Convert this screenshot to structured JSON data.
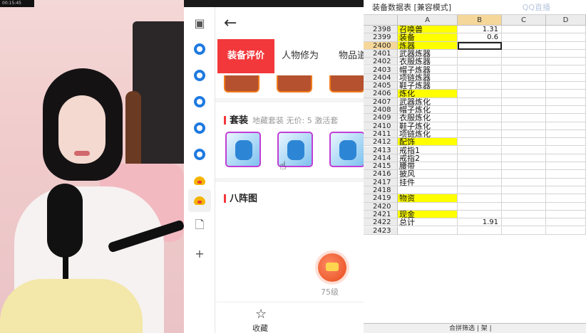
{
  "webcam": {
    "corner_text": "00:15:45"
  },
  "panel": {
    "tabs": [
      "装备评价",
      "人物修为",
      "物品道"
    ],
    "suit_section": {
      "title": "套装",
      "meta": "地藏套装  无价: 5  激活套"
    },
    "formation_section": {
      "title": "八阵图"
    },
    "level": "75级",
    "fav_label": "收藏"
  },
  "sheet": {
    "title": "装备数据表 [兼容模式]",
    "watermark": "QQ直播",
    "columns": [
      "A",
      "B",
      "C",
      "D"
    ],
    "selected_column": "B",
    "rows": [
      {
        "n": "2398",
        "a": "召唤兽",
        "b": "1.31",
        "hl": true
      },
      {
        "n": "2399",
        "a": "装备",
        "b": "0.6",
        "hl": true
      },
      {
        "n": "2400",
        "a": "炼器",
        "b": "",
        "hl": true,
        "sel": true
      },
      {
        "n": "2401",
        "a": "武器炼器",
        "b": ""
      },
      {
        "n": "2402",
        "a": "衣服炼器",
        "b": ""
      },
      {
        "n": "2403",
        "a": "帽子炼器",
        "b": ""
      },
      {
        "n": "2404",
        "a": "项链炼器",
        "b": ""
      },
      {
        "n": "2405",
        "a": "鞋子炼器",
        "b": ""
      },
      {
        "n": "2406",
        "a": "炼化",
        "b": "",
        "hl": true
      },
      {
        "n": "2407",
        "a": "武器炼化",
        "b": ""
      },
      {
        "n": "2408",
        "a": "帽子炼化",
        "b": ""
      },
      {
        "n": "2409",
        "a": "衣服炼化",
        "b": ""
      },
      {
        "n": "2410",
        "a": "鞋子炼化",
        "b": ""
      },
      {
        "n": "2411",
        "a": "项链炼化",
        "b": ""
      },
      {
        "n": "2412",
        "a": "配饰",
        "b": "",
        "hl": true
      },
      {
        "n": "2413",
        "a": "戒指1",
        "b": ""
      },
      {
        "n": "2414",
        "a": "戒指2",
        "b": ""
      },
      {
        "n": "2415",
        "a": "腰带",
        "b": ""
      },
      {
        "n": "2416",
        "a": "披风",
        "b": ""
      },
      {
        "n": "2417",
        "a": "挂件",
        "b": ""
      },
      {
        "n": "2418",
        "a": "",
        "b": ""
      },
      {
        "n": "2419",
        "a": "物资",
        "b": "",
        "hl": true
      },
      {
        "n": "2420",
        "a": "",
        "b": ""
      },
      {
        "n": "2421",
        "a": "现金",
        "b": "",
        "hl": true
      },
      {
        "n": "2422",
        "a": "总计",
        "b": "1.91"
      },
      {
        "n": "2423",
        "a": "",
        "b": ""
      }
    ],
    "footer": "合拼筛选 | 架 |"
  }
}
